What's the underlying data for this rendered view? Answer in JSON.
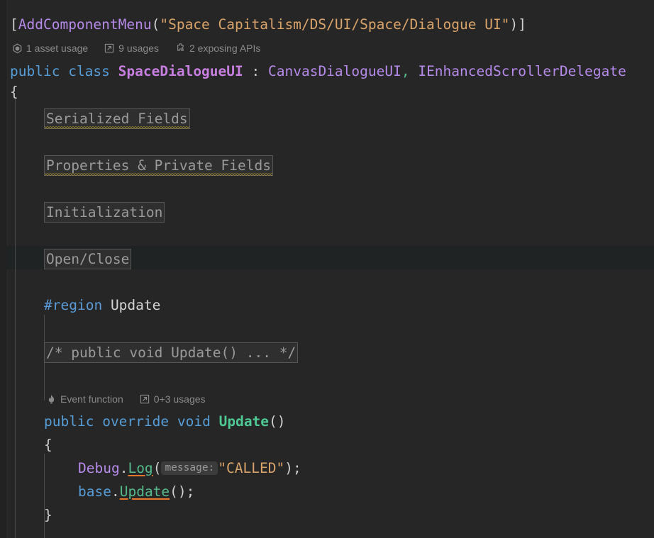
{
  "editor": {
    "background": "#262626",
    "current_line_background": "#1f2324",
    "language": "csharp"
  },
  "code": {
    "attribute_line": {
      "open_bracket": "[",
      "attribute_name": "AddComponentMenu",
      "open_paren": "(",
      "argument": "\"Space Capitalism/DS/UI/Space/Dialogue UI\"",
      "close_paren": ")",
      "close_bracket": "]"
    },
    "class_line": {
      "modifier": "public",
      "keyword": "class",
      "name": "SpaceDialogueUI",
      "colon": " : ",
      "base_class": "CanvasDialogueUI",
      "comma": ", ",
      "interface": "IEnhancedScrollerDelegate"
    },
    "open_brace": "{",
    "folded_regions": [
      {
        "label": "Serialized Fields",
        "has_warning": true
      },
      {
        "label": "Properties & Private Fields",
        "has_warning": true
      },
      {
        "label": "Initialization",
        "has_warning": false
      },
      {
        "label": "Open/Close",
        "has_warning": false,
        "current_line": true
      }
    ],
    "region_directive": {
      "keyword": "#region",
      "name": "Update"
    },
    "folded_comment": "/* public void Update() ... */",
    "method": {
      "modifier": "public",
      "override_kw": "override",
      "return_type": "void",
      "name": "Update",
      "parens": "()",
      "open_brace": "{",
      "close_brace": "}",
      "body": {
        "log_statement": {
          "receiver": "Debug",
          "dot": ".",
          "member": "Log",
          "open_paren": "(",
          "param_hint": "message:",
          "argument": "\"CALLED\"",
          "close_paren": ")",
          "semicolon": ";"
        },
        "base_call": {
          "receiver": "base",
          "dot": ".",
          "member": "Update",
          "parens": "()",
          "semicolon": ";"
        }
      }
    }
  },
  "code_lens": {
    "class_lens": [
      {
        "icon": "unity-asset-icon",
        "label": "1 asset usage"
      },
      {
        "icon": "usages-arrow-icon",
        "label": "9 usages"
      },
      {
        "icon": "puzzle-piece-icon",
        "label": "2 exposing APIs"
      }
    ],
    "method_lens": [
      {
        "icon": "flame-icon",
        "label": "Event function"
      },
      {
        "icon": "usages-arrow-icon",
        "label": "0+3 usages"
      }
    ]
  },
  "colors": {
    "keyword": "#569cd6",
    "type": "#b58ae8",
    "class_name": "#c77fe0",
    "string": "#d9a36a",
    "method": "#4ec994",
    "punctuation": "#cfcfcf",
    "comment_fold": "#9a9a9a",
    "lens_text": "#8a8a8a",
    "warning_squiggle": "#d4b830",
    "member_underline": "#e8772e"
  }
}
